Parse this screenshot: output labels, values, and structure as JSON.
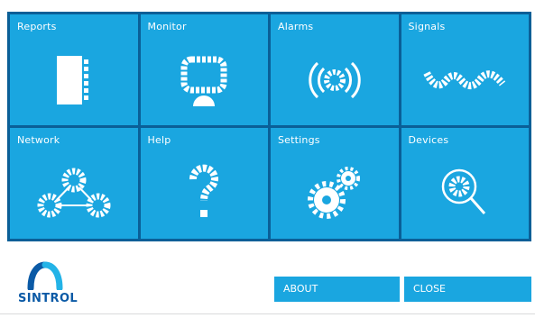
{
  "tiles": [
    {
      "label": "Reports",
      "icon": "reports-icon"
    },
    {
      "label": "Monitor",
      "icon": "monitor-icon"
    },
    {
      "label": "Alarms",
      "icon": "alarms-icon"
    },
    {
      "label": "Signals",
      "icon": "signals-icon"
    },
    {
      "label": "Network",
      "icon": "network-icon"
    },
    {
      "label": "Help",
      "icon": "help-icon"
    },
    {
      "label": "Settings",
      "icon": "settings-icon"
    },
    {
      "label": "Devices",
      "icon": "devices-icon"
    }
  ],
  "footer": {
    "logo_text": "SINTROL",
    "about_label": "ABOUT",
    "close_label": "CLOSE"
  },
  "colors": {
    "tile": "#1aa6e0",
    "grid_border": "#0a5f97",
    "logo_blue": "#0b5aa6",
    "logo_light": "#23b3e7"
  }
}
